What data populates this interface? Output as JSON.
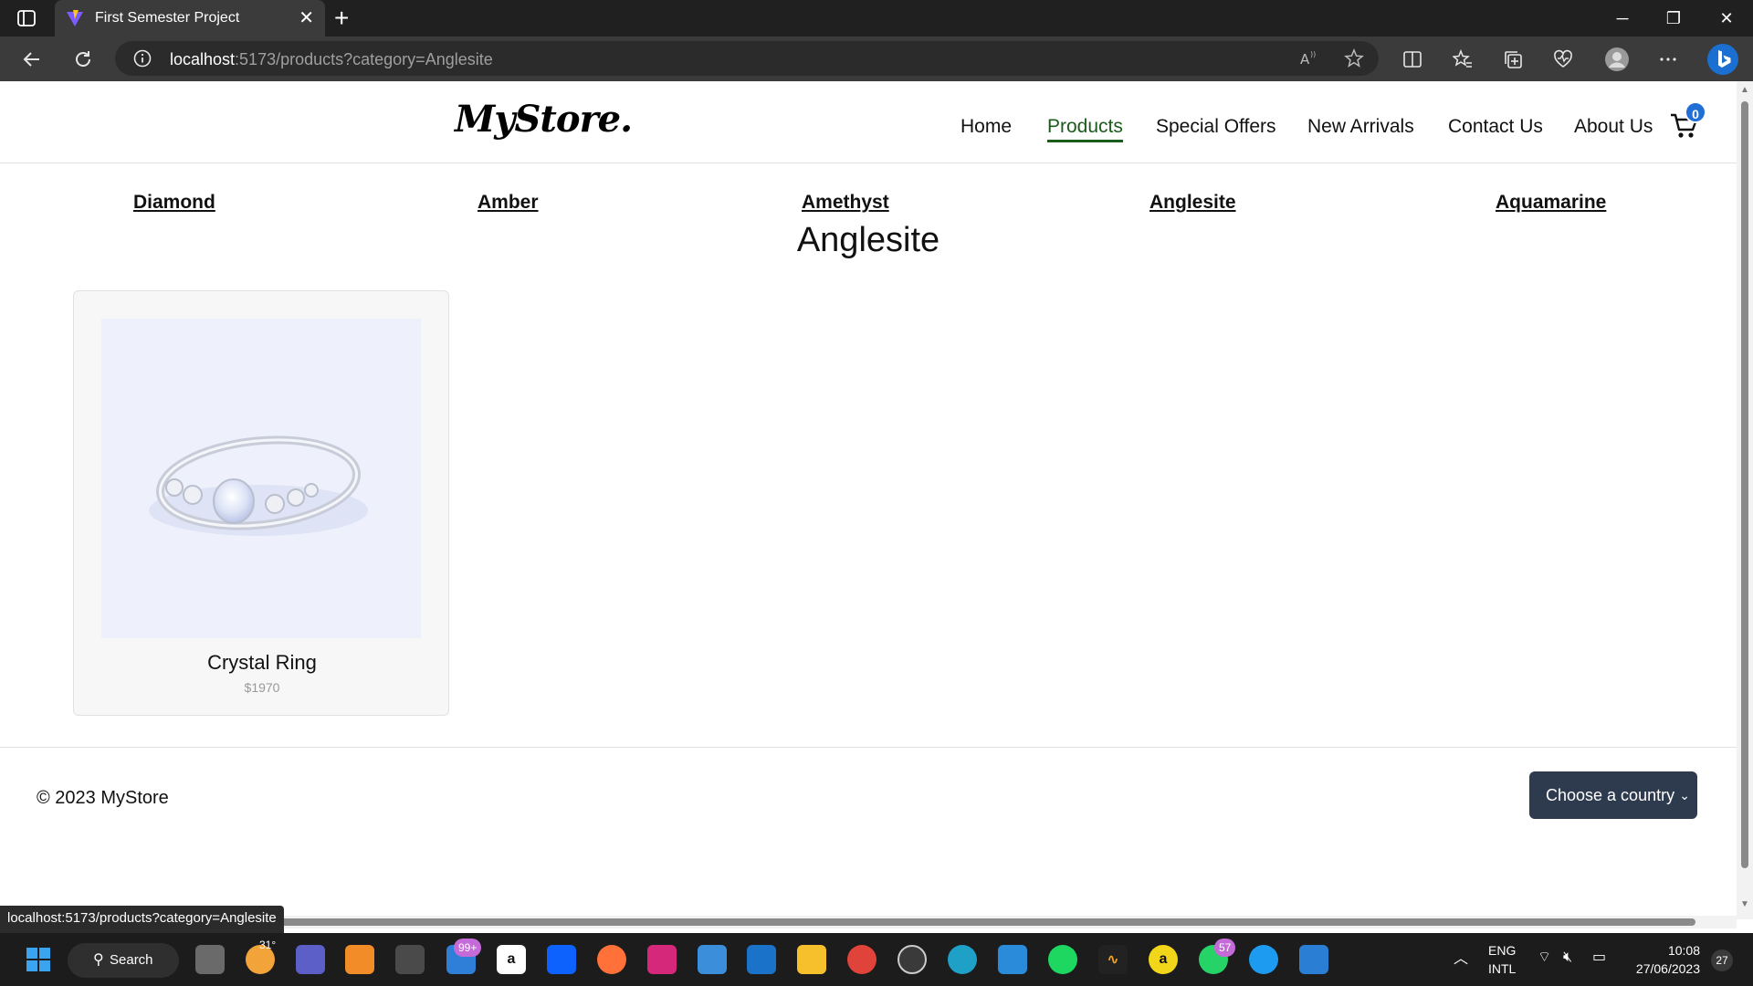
{
  "browser": {
    "tab_title": "First Semester Project",
    "url_host": "localhost",
    "url_rest": ":5173/products?category=Anglesite",
    "status_url": "localhost:5173/products?category=Anglesite"
  },
  "site": {
    "logo": "MyStore.",
    "nav": [
      {
        "label": "Home",
        "active": false
      },
      {
        "label": "Products",
        "active": true
      },
      {
        "label": "Special Offers",
        "active": false
      },
      {
        "label": "New Arrivals",
        "active": false
      },
      {
        "label": "Contact Us",
        "active": false
      },
      {
        "label": "About Us",
        "active": false
      }
    ],
    "cart_count": "0",
    "categories": [
      "Diamond",
      "Amber",
      "Amethyst",
      "Anglesite",
      "Aquamarine"
    ],
    "heading": "Anglesite",
    "products": [
      {
        "name": "Crystal Ring",
        "price": "$1970"
      }
    ],
    "footer": {
      "copyright": "© 2023 MyStore",
      "country_select": "Choose a country"
    }
  },
  "taskbar": {
    "search_label": "Search",
    "weather_temp": "31°",
    "mail_badge": "99+",
    "whatsapp_badge": "57",
    "lang_top": "ENG",
    "lang_bottom": "INTL",
    "time": "10:08",
    "date": "27/06/2023",
    "notifications": "27"
  },
  "colors": {
    "accent_nav": "#1a5c1a",
    "cart_badge": "#1f6fd6",
    "select_bg": "#2e3b4e"
  }
}
